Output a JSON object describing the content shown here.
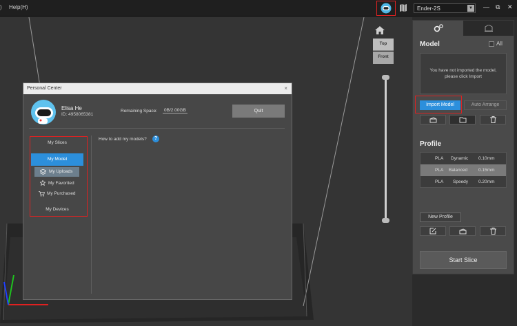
{
  "menubar": {
    "left_glyph": ")",
    "help_label": "Help(H)"
  },
  "printer": {
    "selected": "Ender-2S"
  },
  "window_controls": {
    "minimize": "—",
    "restore": "⧉",
    "close": "✕"
  },
  "view_cube": {
    "top_label": "Top",
    "front_label": "Front"
  },
  "slider": {
    "upper_level": 1.0,
    "lower_level": 0.0
  },
  "side_panel": {
    "model": {
      "title": "Model",
      "all_label": "All",
      "empty_message_line1": "You have not imported the model,",
      "empty_message_line2": "please click Import",
      "import_button": "Import Model",
      "auto_arrange_button": "Auto Arrange"
    },
    "profile": {
      "title": "Profile",
      "rows": [
        {
          "material": "PLA",
          "name": "Dynamic",
          "layer": "0.10mm",
          "selected": false
        },
        {
          "material": "PLA",
          "name": "Balanced",
          "layer": "0.15mm",
          "selected": true
        },
        {
          "material": "PLA",
          "name": "Speedy",
          "layer": "0.20mm",
          "selected": false
        }
      ],
      "new_profile_button": "New Profile"
    },
    "start_slice_button": "Start Slice"
  },
  "dialog": {
    "title": "Personal Center",
    "close": "×",
    "user": {
      "name": "Elisa He",
      "id_label": "ID:",
      "id_value": "4958065381"
    },
    "remaining_label": "Remaining Space:",
    "remaining_value": "0B/2.00GB",
    "quit_button": "Quit",
    "menu": {
      "my_slices": "My Slices",
      "my_model": "My Model",
      "my_uploads": "My Uploads",
      "my_favorited": "My Favorited",
      "my_purchased": "My Purchased",
      "my_devices": "My Devices"
    },
    "howto_text": "How to add my models?",
    "help_badge": "?"
  },
  "colors": {
    "accent": "#2c8fdc",
    "highlight_outline": "#dd2222"
  }
}
